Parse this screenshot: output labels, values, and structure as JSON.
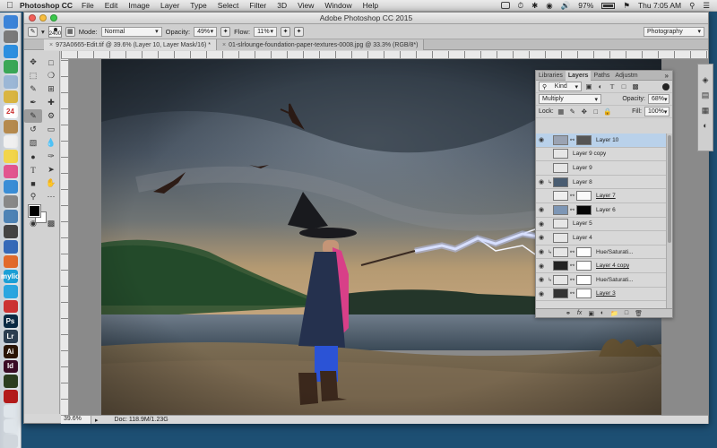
{
  "menubar": {
    "app_name": "Photoshop CC",
    "items": [
      "File",
      "Edit",
      "Image",
      "Layer",
      "Type",
      "Select",
      "Filter",
      "3D",
      "View",
      "Window",
      "Help"
    ],
    "battery": "97%",
    "clock": "Thu 7:05 AM"
  },
  "window": {
    "title": "Adobe Photoshop CC 2015"
  },
  "options_bar": {
    "brush_size": "2400",
    "mode_label": "Mode:",
    "mode_value": "Normal",
    "opacity_label": "Opacity:",
    "opacity_value": "49%",
    "flow_label": "Flow:",
    "flow_value": "11%",
    "workspace": "Photography"
  },
  "tabs": [
    {
      "label": "973A0665-Edit.tif @ 39.6% (Layer 10, Layer Mask/16) *",
      "active": true
    },
    {
      "label": "01-slrlounge-foundation-paper-textures-0008.jpg @ 33.3% (RGB/8*)",
      "active": false
    }
  ],
  "status": {
    "zoom": "39.6%",
    "doc": "Doc: 118.9M/1.23G"
  },
  "layers_panel": {
    "tabs": [
      "Libraries",
      "Layers",
      "Paths",
      "Adjustm"
    ],
    "active_tab": "Layers",
    "filter_value": "Kind",
    "blend_mode": "Multiply",
    "opacity_label": "Opacity:",
    "opacity_value": "68%",
    "lock_label": "Lock:",
    "fill_label": "Fill:",
    "fill_value": "100%",
    "layers": [
      {
        "name": "Layer 10",
        "visible": true,
        "selected": true,
        "mask": true,
        "underline": false,
        "clip": false,
        "thumb": "#9aa3b3",
        "maskthumb": "#555"
      },
      {
        "name": "Layer 9 copy",
        "visible": false,
        "selected": false,
        "mask": false,
        "underline": false,
        "clip": false,
        "thumb": "#e6e6e6"
      },
      {
        "name": "Layer 9",
        "visible": false,
        "selected": false,
        "mask": false,
        "underline": false,
        "clip": false,
        "thumb": "#e6e6e6"
      },
      {
        "name": "Layer 8",
        "visible": true,
        "selected": false,
        "mask": false,
        "underline": false,
        "clip": true,
        "thumb": "#4a5d72"
      },
      {
        "name": "Layer 7",
        "visible": false,
        "selected": false,
        "mask": true,
        "underline": true,
        "clip": false,
        "thumb": "#eeeeee",
        "maskthumb": "#fafafa"
      },
      {
        "name": "Layer 6",
        "visible": true,
        "selected": false,
        "mask": true,
        "underline": false,
        "clip": false,
        "thumb": "#7d96b5",
        "maskthumb": "#050505"
      },
      {
        "name": "Layer 5",
        "visible": true,
        "selected": false,
        "mask": false,
        "underline": false,
        "clip": false,
        "thumb": "#e6e6e6"
      },
      {
        "name": "Layer 4",
        "visible": true,
        "selected": false,
        "mask": false,
        "underline": false,
        "clip": false,
        "thumb": "#e6e6e6"
      },
      {
        "name": "Hue/Saturati...",
        "visible": true,
        "selected": false,
        "mask": true,
        "underline": false,
        "clip": true,
        "thumb": "#e6e6e6",
        "maskthumb": "#ffffff"
      },
      {
        "name": "Layer 4 copy",
        "visible": true,
        "selected": false,
        "mask": true,
        "underline": true,
        "clip": false,
        "thumb": "#222222",
        "maskthumb": "#ffffff"
      },
      {
        "name": "Hue/Saturati...",
        "visible": true,
        "selected": false,
        "mask": true,
        "underline": false,
        "clip": true,
        "thumb": "#e6e6e6",
        "maskthumb": "#ffffff"
      },
      {
        "name": "Layer 3",
        "visible": true,
        "selected": false,
        "mask": true,
        "underline": true,
        "clip": false,
        "thumb": "#333333",
        "maskthumb": "#ffffff"
      }
    ]
  },
  "dock_apps": [
    {
      "name": "finder",
      "color": "#3b84d9",
      "label": ""
    },
    {
      "name": "launchpad",
      "color": "#7a7a7a",
      "label": ""
    },
    {
      "name": "safari",
      "color": "#2c8fe0",
      "label": ""
    },
    {
      "name": "chrome",
      "color": "#3aa757",
      "label": ""
    },
    {
      "name": "mail",
      "color": "#9bb7d6",
      "label": ""
    },
    {
      "name": "notes",
      "color": "#d9b542",
      "label": ""
    },
    {
      "name": "calendar",
      "color": "#ffffff",
      "label": "24"
    },
    {
      "name": "contacts",
      "color": "#b58a4e",
      "label": ""
    },
    {
      "name": "reminders",
      "color": "#f0f0f0",
      "label": ""
    },
    {
      "name": "stickies",
      "color": "#f2d54b",
      "label": ""
    },
    {
      "name": "itunes",
      "color": "#e2558f",
      "label": ""
    },
    {
      "name": "appstore",
      "color": "#3a8dd6",
      "label": ""
    },
    {
      "name": "preferences",
      "color": "#888888",
      "label": ""
    },
    {
      "name": "photos",
      "color": "#4e83b5",
      "label": ""
    },
    {
      "name": "terminal",
      "color": "#444444",
      "label": ""
    },
    {
      "name": "search",
      "color": "#3569b8",
      "label": ""
    },
    {
      "name": "stock-app",
      "color": "#e26a2b",
      "label": ""
    },
    {
      "name": "mylio",
      "color": "#1b9fd6",
      "label": "mylio"
    },
    {
      "name": "skype",
      "color": "#2aa6e0",
      "label": ""
    },
    {
      "name": "lightroom-classic",
      "color": "#cc3333",
      "label": ""
    },
    {
      "name": "photoshop",
      "color": "#0a2a44",
      "label": "Ps"
    },
    {
      "name": "lightroom",
      "color": "#2c3e50",
      "label": "Lr"
    },
    {
      "name": "illustrator",
      "color": "#2b1505",
      "label": "Ai"
    },
    {
      "name": "indesign",
      "color": "#3a0b24",
      "label": "Id"
    },
    {
      "name": "bridge",
      "color": "#2b3d1e",
      "label": ""
    },
    {
      "name": "acrobat",
      "color": "#b31b1b",
      "label": ""
    },
    {
      "name": "documents",
      "color": "#dfe5ea",
      "label": ""
    },
    {
      "name": "downloads",
      "color": "#dfe5ea",
      "label": ""
    },
    {
      "name": "trash",
      "color": "#d0d6dc",
      "label": ""
    }
  ]
}
